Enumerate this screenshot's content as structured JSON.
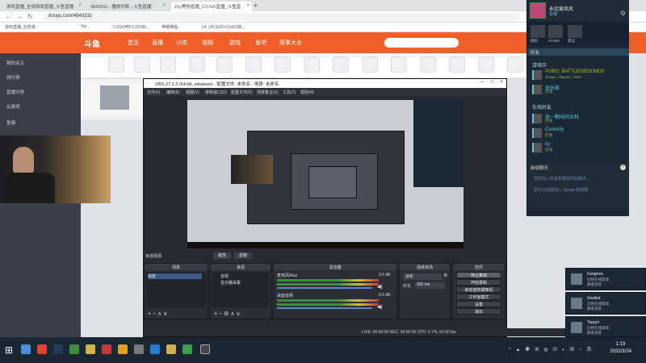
{
  "browser": {
    "tabs": [
      {
        "title": "游戏直播_全部游戏直播_斗鱼直播"
      },
      {
        "title": "4843331 - 播放列表 - 斗鱼直播"
      },
      {
        "title": "Zzy黑狗直播_CS:GO直播_斗鱼直"
      }
    ],
    "url": "douyu.com/4843331",
    "bookmarks": [
      "游戏直播_全部游...",
      "Vip...",
      "CSGO吧CS:GO玩...",
      "神曜降临...",
      "LK | ACSGO-CSGO航..."
    ]
  },
  "douyu": {
    "logo": "斗鱼",
    "nav": [
      "首页",
      "直播",
      "分类",
      "视频",
      "游戏",
      "鱼吧",
      "赛事大全"
    ],
    "sidebar": [
      {
        "label": "我的关注"
      },
      {
        "label": "排行榜"
      },
      {
        "label": "直播分类"
      },
      {
        "label": "云游戏"
      },
      {
        "label": "鱼塘"
      }
    ]
  },
  "obs": {
    "title": "OBS 27.2.3 (64-bit, windows) - 配置文件: 未命名 - 场景: 未命名",
    "menu": [
      "文件(F)",
      "编辑(E)",
      "视图(V)",
      "停靠窗口(D)",
      "配置文件(P)",
      "场景集合(S)",
      "工具(T)",
      "帮助(H)"
    ],
    "preview_label": "未选择源",
    "preview_buttons": [
      "属性",
      "滤镜"
    ],
    "docks": {
      "scenes": {
        "title": "场景",
        "items": [
          "场景"
        ]
      },
      "sources": {
        "title": "来源",
        "items": [
          "音频",
          "显示器采集"
        ]
      },
      "mixer": {
        "title": "混音器",
        "channels": [
          {
            "name": "麦克风/Aux",
            "db": "0.0 dB"
          },
          {
            "name": "桌面音频",
            "db": "0.0 dB"
          }
        ]
      },
      "transitions": {
        "title": "场景转场",
        "type": "淡化",
        "duration_label": "时长",
        "duration": "300 ms"
      },
      "controls": {
        "title": "控件",
        "buttons": [
          "停止推流",
          "开始录制",
          "启动虚拟摄像机",
          "工作室模式",
          "设置",
          "退出"
        ]
      }
    },
    "status": "LIVE: 00:00:00   REC: 00:00:00   CPU: 0.7%, 60.00 fps"
  },
  "steam": {
    "username": "永远爱凤凤",
    "status": "在线",
    "groups": [
      "群组",
      "Smoke",
      "建议"
    ],
    "friends_header": "好友",
    "ingame_header": "游戏中",
    "ingame": [
      {
        "name": "PUBG: BATTLEGROUNDS",
        "sub": "Tempo, Allegato, 1918 · ...",
        "icon": "pubg-icon"
      }
    ],
    "ingame_friend": {
      "name": "去玩家",
      "sub": "在线"
    },
    "online_header": "在线好友",
    "online": [
      {
        "name": "来一颗闲同五科",
        "sub": "在线"
      },
      {
        "name": "Curiosity",
        "sub": "在线"
      },
      {
        "name": "ky",
        "sub": "在线"
      }
    ],
    "news": {
      "title": "新组聊天",
      "lines": [
        "您可加入所有新群组开始聊天...",
        "您可以创建加入 Steam 新闻群"
      ]
    }
  },
  "toasts": [
    {
      "name": "Fangtree",
      "msg": "已经在线游戏\n群发消息"
    },
    {
      "name": "Smiiled",
      "msg": "已经在线游戏\n群发消息"
    },
    {
      "name": "Topper",
      "msg": "已经在线游戏\n群发消息"
    }
  ],
  "taskbar": {
    "time": "1:19",
    "date": "2022/3/24"
  },
  "colors": {
    "douyu_orange": "#f05f27",
    "steam_bg": "#1b2838",
    "steam_online": "#57cbde",
    "steam_ingame": "#a3cf06",
    "obs_bg": "#272a33"
  }
}
